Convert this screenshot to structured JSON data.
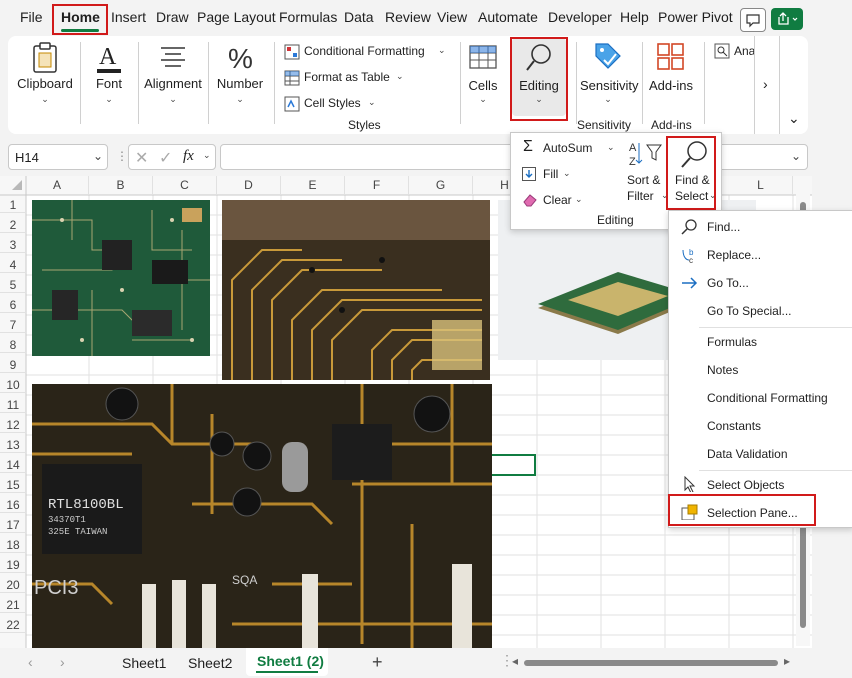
{
  "menubar": {
    "tabs": [
      "File",
      "Home",
      "Insert",
      "Draw",
      "Page Layout",
      "Formulas",
      "Data",
      "Review",
      "View",
      "Automate",
      "Developer",
      "Help",
      "Power Pivot"
    ],
    "active": "Home"
  },
  "ribbon": {
    "clipboard": "Clipboard",
    "font": "Font",
    "alignment": "Alignment",
    "number": "Number",
    "conditional_formatting": "Conditional Formatting",
    "format_as_table": "Format as Table",
    "cell_styles": "Cell Styles",
    "styles_group": "Styles",
    "cells": "Cells",
    "editing": "Editing",
    "sensitivity": "Sensitivity",
    "sensitivity_group": "Sensitivity",
    "addins": "Add-ins",
    "addins_group": "Add-ins",
    "analyze": "Ana"
  },
  "formula_bar": {
    "name_box": "H14",
    "fx": "fx"
  },
  "columns": [
    "A",
    "B",
    "C",
    "D",
    "E",
    "F",
    "G",
    "H",
    "L"
  ],
  "rows": [
    "1",
    "2",
    "3",
    "4",
    "5",
    "6",
    "7",
    "8",
    "9",
    "10",
    "11",
    "12",
    "13",
    "14",
    "15",
    "16",
    "17",
    "18",
    "19",
    "20",
    "21",
    "22"
  ],
  "editing_panel": {
    "autosum": "AutoSum",
    "fill": "Fill",
    "clear": "Clear",
    "sort_filter_1": "Sort &",
    "sort_filter_2": "Filter",
    "find_select_1": "Find &",
    "find_select_2": "Select",
    "group": "Editing"
  },
  "find_menu": {
    "items": [
      "Find...",
      "Replace...",
      "Go To...",
      "Go To Special...",
      "Formulas",
      "Notes",
      "Conditional Formatting",
      "Constants",
      "Data Validation",
      "Select Objects",
      "Selection Pane..."
    ]
  },
  "pcb_labels": {
    "chip": "RTL8100BL",
    "chip_line2": "34370T1",
    "chip_line3": "325E TAIWAN",
    "pci": "PCI3",
    "sqa": "SQA"
  },
  "sheets": [
    "Sheet1",
    "Sheet2",
    "Sheet1 (2)"
  ],
  "active_sheet": "Sheet1 (2)",
  "colors": {
    "excel_green": "#107c41",
    "highlight_red": "#d11a1a",
    "pcb_green": "#1f5a3a"
  }
}
